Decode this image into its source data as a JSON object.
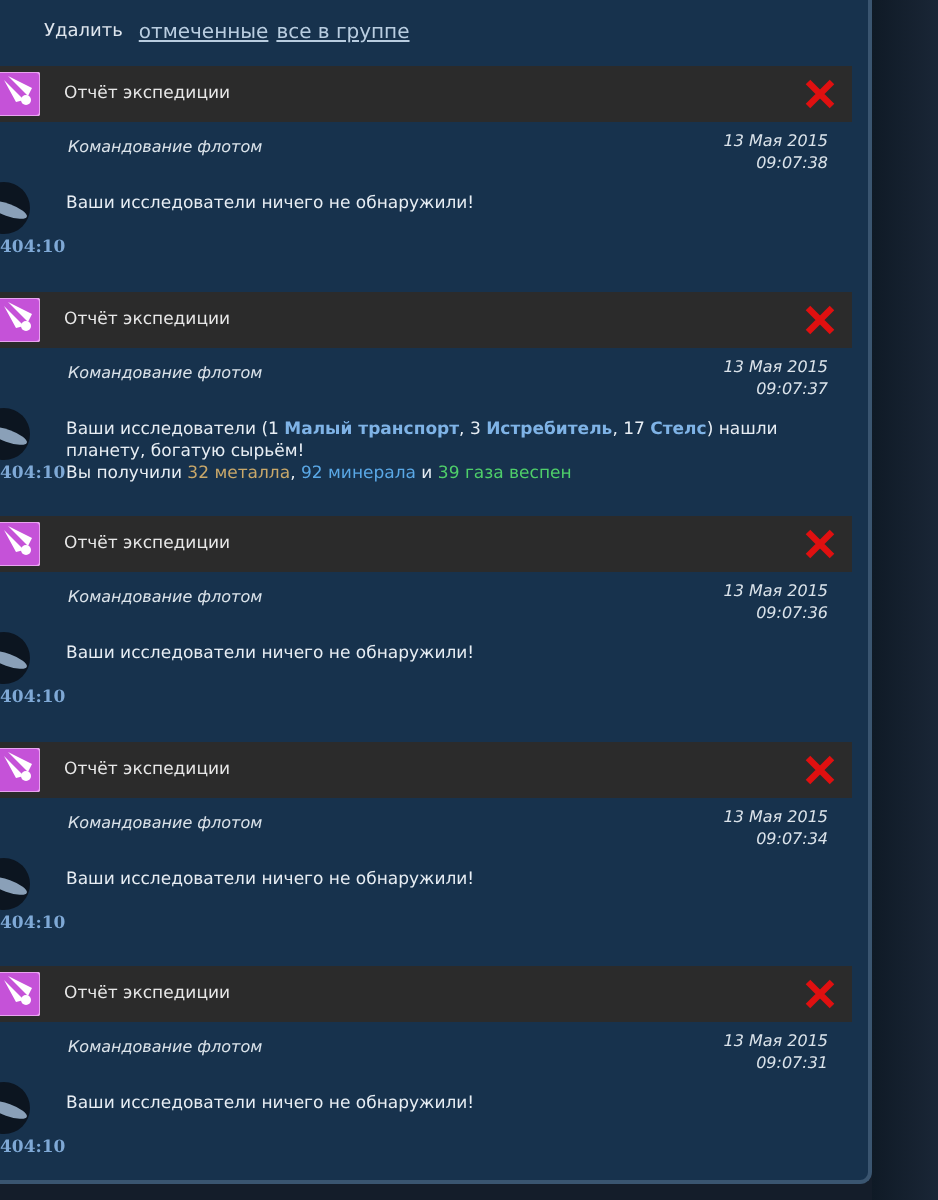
{
  "toolbar": {
    "label": "Удалить",
    "links": [
      "отмеченные",
      "все в группе"
    ]
  },
  "messages": [
    {
      "title": "Отчёт экспедиции",
      "sender": "Командование флотом",
      "date": "13 Мая 2015",
      "time": "09:07:38",
      "coords": "404:10",
      "paragraphs": [
        [
          {
            "kind": "plain",
            "text": "Ваши исследователи ничего не обнаружили!"
          }
        ]
      ]
    },
    {
      "title": "Отчёт экспедиции",
      "sender": "Командование флотом",
      "date": "13 Мая 2015",
      "time": "09:07:37",
      "coords": "404:10",
      "paragraphs": [
        [
          {
            "kind": "plain",
            "text": "Ваши исследователи (1 "
          },
          {
            "kind": "ship",
            "text": "Малый транспорт"
          },
          {
            "kind": "plain",
            "text": ", 3 "
          },
          {
            "kind": "ship",
            "text": "Истребитель"
          },
          {
            "kind": "plain",
            "text": ", 17 "
          },
          {
            "kind": "ship",
            "text": "Стелс"
          },
          {
            "kind": "plain",
            "text": ") нашли планету, богатую сырьём!"
          }
        ],
        [
          {
            "kind": "plain",
            "text": "Вы получили "
          },
          {
            "kind": "metal",
            "text": "32 металла"
          },
          {
            "kind": "plain",
            "text": ", "
          },
          {
            "kind": "mineral",
            "text": "92 минерала"
          },
          {
            "kind": "plain",
            "text": " и "
          },
          {
            "kind": "gas",
            "text": "39 газа веспен"
          }
        ]
      ]
    },
    {
      "title": "Отчёт экспедиции",
      "sender": "Командование флотом",
      "date": "13 Мая 2015",
      "time": "09:07:36",
      "coords": "404:10",
      "paragraphs": [
        [
          {
            "kind": "plain",
            "text": "Ваши исследователи ничего не обнаружили!"
          }
        ]
      ]
    },
    {
      "title": "Отчёт экспедиции",
      "sender": "Командование флотом",
      "date": "13 Мая 2015",
      "time": "09:07:34",
      "coords": "404:10",
      "paragraphs": [
        [
          {
            "kind": "plain",
            "text": "Ваши исследователи ничего не обнаружили!"
          }
        ]
      ]
    },
    {
      "title": "Отчёт экспедиции",
      "sender": "Командование флотом",
      "date": "13 Мая 2015",
      "time": "09:07:31",
      "coords": "404:10",
      "paragraphs": [
        [
          {
            "kind": "plain",
            "text": "Ваши исследователи ничего не обнаружили!"
          }
        ]
      ]
    }
  ]
}
